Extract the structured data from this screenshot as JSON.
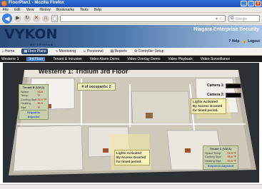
{
  "window": {
    "title": "FloorPlan1 - Mozilla Firefox",
    "controls": [
      "_",
      "□",
      "x"
    ]
  },
  "menubar": [
    "File",
    "Edit",
    "View",
    "History",
    "Bookmarks",
    "Tools",
    "Help"
  ],
  "toolbar": {
    "back_icon": "back-arrow-icon",
    "forward_icon": "forward-arrow-icon",
    "reload_icon": "reload-icon",
    "stop_icon": "stop-icon",
    "home_icon": "home-icon",
    "url": "",
    "search_placeholder": "Google"
  },
  "header": {
    "logo_text": "VYKON",
    "logo_sub": "BY TRIDIUM",
    "brand": "Niagara Enterprise Security",
    "links": [
      "Help",
      "Logout"
    ]
  },
  "nav": {
    "items": [
      {
        "icon": "⌂",
        "label": "Home",
        "active": false
      },
      {
        "icon": "▦",
        "label": "Floor Plans",
        "active": true
      },
      {
        "icon": "∿",
        "label": "Monitoring",
        "active": false
      },
      {
        "icon": "☺",
        "label": "Personnel",
        "active": false
      },
      {
        "icon": "▤",
        "label": "Reports",
        "active": false
      },
      {
        "icon": "⚙",
        "label": "Controller Setup",
        "active": false
      }
    ]
  },
  "subnav": {
    "items": [
      {
        "label": "Westerre 1",
        "active": false
      },
      {
        "label": "3rd Floor",
        "active": true
      },
      {
        "label": "Tenant & Intrusion",
        "active": false
      },
      {
        "label": "Video Alarm Demo",
        "active": false
      },
      {
        "label": "Video Overlay Demo",
        "active": false
      },
      {
        "label": "Video Playback",
        "active": false
      },
      {
        "label": "Video Surveillance",
        "active": false
      }
    ]
  },
  "floorplan": {
    "title": "Westerre 1: Tridium 3rd Floor",
    "cameras": [
      "Camera 1:",
      "Camera 2:"
    ],
    "occupants": "# of occupants: 2",
    "tenant_b": {
      "name": "Tenant B (VAV2)",
      "rows": [
        {
          "label": "Space Temp:",
          "value": "73.5 °F"
        },
        {
          "label": "Cooling Stpt:",
          "value": "75.0 °F"
        },
        {
          "label": "Heating Stpt:",
          "value": "70.0 °F"
        }
      ],
      "status": "Setpoints Adjusted"
    },
    "tenant_c": {
      "name": "Tenant C (VAV1)",
      "rows": [
        {
          "label": "Space Temp:",
          "value": "73.0 °F"
        },
        {
          "label": "Cooling Stpt:",
          "value": "75.0 °F"
        },
        {
          "label": "Heating Stpt:",
          "value": "70.0 °F"
        }
      ],
      "status": "Setpoints Adjusted"
    },
    "alert_top": [
      "Lights Activated",
      "By Access Granted",
      "for timed period."
    ],
    "alert_bottom": [
      "Lights Activated",
      "By Access Granted",
      "for timed period."
    ]
  }
}
